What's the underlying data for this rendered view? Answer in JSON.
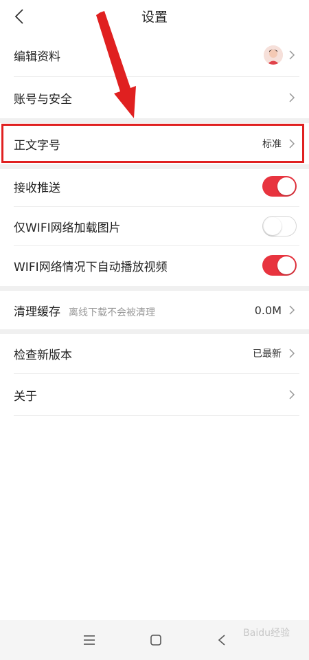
{
  "header": {
    "title": "设置",
    "back_icon": "chevron-left-icon"
  },
  "rows": {
    "edit_profile": {
      "label": "编辑资料",
      "avatar_icon": "user-avatar-icon"
    },
    "account_security": {
      "label": "账号与安全"
    },
    "font_size": {
      "label": "正文字号",
      "value": "标准"
    },
    "receive_push": {
      "label": "接收推送",
      "toggle": "on"
    },
    "wifi_images": {
      "label": "仅WIFI网络加载图片",
      "toggle": "off"
    },
    "wifi_autoplay": {
      "label": "WIFI网络情况下自动播放视频",
      "toggle": "on"
    },
    "clear_cache": {
      "label": "清理缓存",
      "hint": "离线下载不会被清理",
      "value": "0.0M"
    },
    "check_update": {
      "label": "检查新版本",
      "value": "已最新"
    },
    "about": {
      "label": "关于"
    }
  },
  "colors": {
    "accent": "#e8343f",
    "highlight": "#e02020",
    "divider": "#ececec",
    "gap": "#f0f0f0"
  },
  "navbar": {
    "menu_icon": "menu-icon",
    "home_icon": "square-home-icon",
    "back_icon": "triangle-back-icon"
  },
  "watermark": "Baidu经验"
}
